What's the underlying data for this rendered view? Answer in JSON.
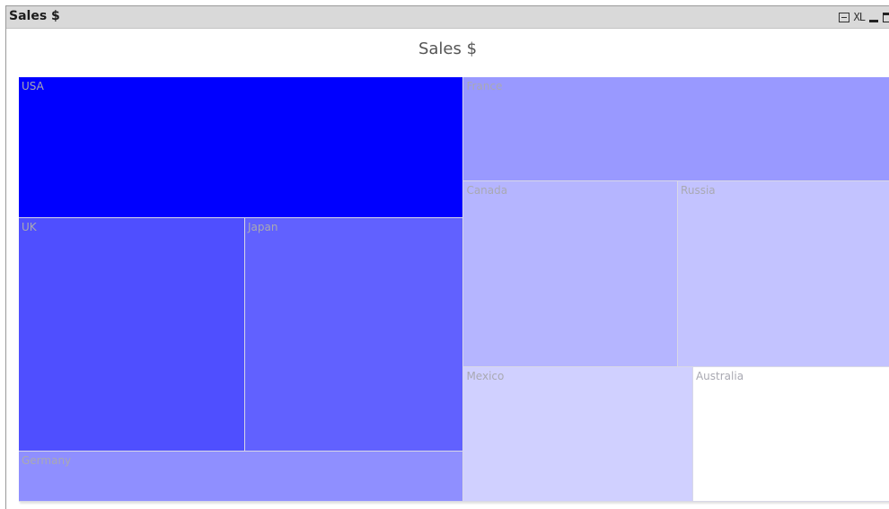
{
  "window": {
    "title": "Sales $",
    "controls": {
      "print_icon": "print-icon",
      "xl_label": "XL",
      "minimize_icon": "minimize-icon",
      "maximize_icon": "maximize-icon"
    }
  },
  "chart_data": {
    "type": "treemap",
    "title": "Sales $",
    "colors": {
      "max": "#0000ff",
      "min": "#ffffff"
    },
    "items": [
      {
        "label": "USA",
        "value": 71000,
        "color": "#0000ff"
      },
      {
        "label": "UK",
        "value": 59500,
        "color": "#4f4fff"
      },
      {
        "label": "Japan",
        "value": 57500,
        "color": "#6161ff"
      },
      {
        "label": "Germany",
        "value": 25500,
        "color": "#8f8fff"
      },
      {
        "label": "France",
        "value": 50000,
        "color": "#9999ff"
      },
      {
        "label": "Canada",
        "value": 45000,
        "color": "#b5b5ff"
      },
      {
        "label": "Russia",
        "value": 44500,
        "color": "#c3c3ff"
      },
      {
        "label": "Mexico",
        "value": 35000,
        "color": "#d0d0ff"
      },
      {
        "label": "Australia",
        "value": 30000,
        "color": "#ffffff"
      }
    ]
  }
}
